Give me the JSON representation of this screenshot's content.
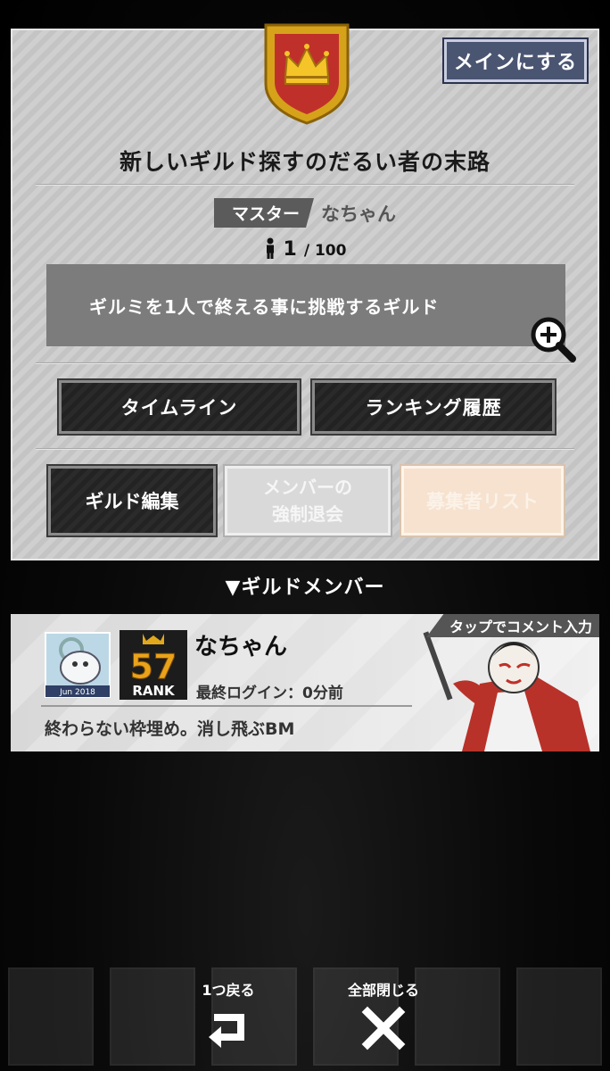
{
  "guild": {
    "main_button": "メインにする",
    "name": "新しいギルド探すのだるい者の末路",
    "master_label": "マスター",
    "master_name": "なちゃん",
    "member_count": "1",
    "member_max": "/ 100",
    "description": "ギルミを1人で終える事に挑戦するギルド"
  },
  "actions": {
    "timeline": "タイムライン",
    "ranking_history": "ランキング履歴",
    "guild_edit": "ギルド編集",
    "force_leave_line1": "メンバーの",
    "force_leave_line2": "強制退会",
    "applicants": "募集者リスト"
  },
  "members_header": "▼ギルドメンバー",
  "member": {
    "tap_hint": "タップでコメント入力",
    "avatar_caption": "Jun 2018",
    "rank_number": "57",
    "rank_label": "RANK",
    "name": "なちゃん",
    "last_login": "最終ログイン：0分前",
    "comment": "終わらない枠埋め。消し飛ぶBM"
  },
  "footer": {
    "back_label": "1つ戻る",
    "close_all_label": "全部閉じる"
  },
  "colors": {
    "panel": "#c9c9c9",
    "main_button": "#4a5572",
    "emblem_red": "#c0392b",
    "emblem_gold": "#d4a017"
  }
}
